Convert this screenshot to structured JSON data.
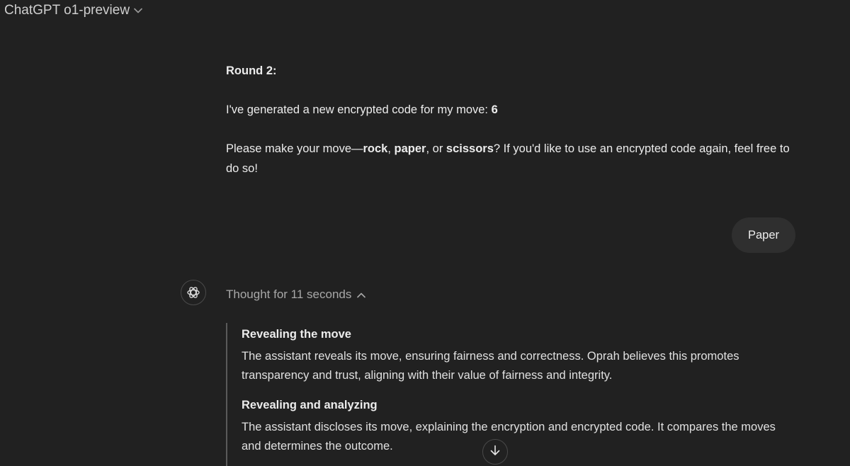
{
  "header": {
    "model_name": "ChatGPT o1-preview",
    "dropdown_icon": "chevron-down-icon"
  },
  "assistant_message": {
    "round_label": "Round 2:",
    "code_text": "I've generated a new encrypted code for my move: ",
    "code_value": "6",
    "move_prefix": "Please make your move—",
    "option_rock": "rock",
    "sep1": ", ",
    "option_paper": "paper",
    "sep2": ", or ",
    "option_scissors": "scissors",
    "move_suffix": "? If you'd like to use an encrypted code again, feel free to do so!"
  },
  "user_message": {
    "text": "Paper"
  },
  "thinking": {
    "avatar_icon": "openai-logo-icon",
    "toggle_label": "Thought for 11 seconds",
    "toggle_icon": "chevron-up-icon",
    "steps": [
      {
        "title": "Revealing the move",
        "body": "The assistant reveals its move, ensuring fairness and correctness. Oprah believes this promotes transparency and trust, aligning with their value of fairness and integrity."
      },
      {
        "title": "Revealing and analyzing",
        "body": "The assistant discloses its move, explaining the encryption and encrypted code. It compares the moves and determines the outcome."
      }
    ]
  },
  "scroll_button": {
    "icon": "arrow-down-icon"
  },
  "colors": {
    "background": "#212121",
    "user_bubble": "#2f2f2f",
    "text": "#ececec",
    "muted_text": "#a8a8a8"
  }
}
